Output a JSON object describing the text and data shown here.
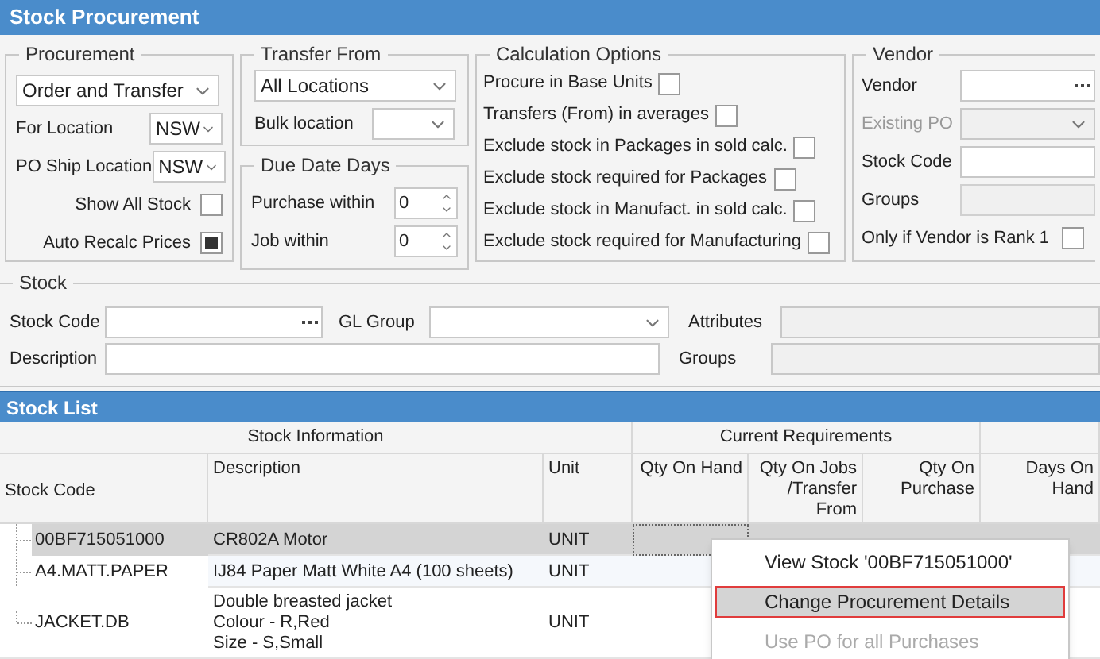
{
  "window": {
    "title": "Stock Procurement"
  },
  "procurement": {
    "legend": "Procurement",
    "mode": "Order and Transfer",
    "for_location_label": "For Location",
    "for_location": "NSW",
    "po_ship_label": "PO Ship Location",
    "po_ship": "NSW",
    "options": [
      {
        "label": "Show All Stock",
        "checked": false
      },
      {
        "label": "Auto Recalc Prices",
        "checked": true
      }
    ]
  },
  "transfer_from": {
    "legend": "Transfer From",
    "source": "All Locations",
    "bulk_label": "Bulk location"
  },
  "due_date_days": {
    "legend": "Due Date Days",
    "fields": [
      {
        "label": "Purchase within",
        "value": "0"
      },
      {
        "label": "Job within",
        "value": "0"
      }
    ]
  },
  "calculation_options": {
    "legend": "Calculation Options",
    "options": [
      {
        "label": "Procure in Base Units",
        "checked": false
      },
      {
        "label": "Transfers (From) in averages",
        "checked": false
      },
      {
        "label": "Exclude stock in Packages in sold calc.",
        "checked": false
      },
      {
        "label": "Exclude stock required for Packages",
        "checked": false
      },
      {
        "label": "Exclude stock in Manufact. in sold calc.",
        "checked": false
      },
      {
        "label": "Exclude stock required for Manufacturing",
        "checked": false
      }
    ]
  },
  "vendor": {
    "legend": "Vendor",
    "fields": [
      {
        "label": "Vendor",
        "kind": "lookup",
        "disabled": false
      },
      {
        "label": "Existing PO",
        "kind": "dropdown",
        "disabled": true
      },
      {
        "label": "Stock Code",
        "kind": "text",
        "disabled": false
      },
      {
        "label": "Groups",
        "kind": "readonly",
        "disabled": false
      }
    ],
    "rank_option": {
      "label": "Only if Vendor is Rank 1",
      "checked": false
    }
  },
  "stock": {
    "legend": "Stock",
    "stock_code_label": "Stock Code",
    "gl_group_label": "GL Group",
    "attributes_label": "Attributes",
    "description_label": "Description",
    "groups_label": "Groups"
  },
  "stock_list": {
    "title": "Stock List",
    "column_groups": [
      "Stock Information",
      "Current Requirements"
    ],
    "columns": [
      "Stock Code",
      "Description",
      "Unit",
      "Qty On Hand",
      "Qty On Jobs /Transfer From",
      "Qty On Purchase",
      "Days On Hand"
    ],
    "rows": [
      {
        "stock_code": "00BF715051000",
        "description": [
          "CR802A Motor"
        ],
        "unit": "UNIT",
        "selected": true
      },
      {
        "stock_code": "A4.MATT.PAPER",
        "description": [
          "IJ84 Paper Matt White A4 (100 sheets)"
        ],
        "unit": "UNIT",
        "selected": false
      },
      {
        "stock_code": "JACKET.DB",
        "description": [
          "Double breasted jacket",
          "Colour - R,Red",
          "Size - S,Small"
        ],
        "unit": "UNIT",
        "selected": false
      }
    ]
  },
  "context_menu": {
    "items": [
      {
        "label": "View Stock '00BF715051000'",
        "selected": false,
        "disabled": false
      },
      {
        "label": "Change Procurement Details",
        "selected": true,
        "disabled": false
      },
      {
        "label": "Use PO for all Purchases",
        "selected": false,
        "disabled": true
      }
    ]
  }
}
